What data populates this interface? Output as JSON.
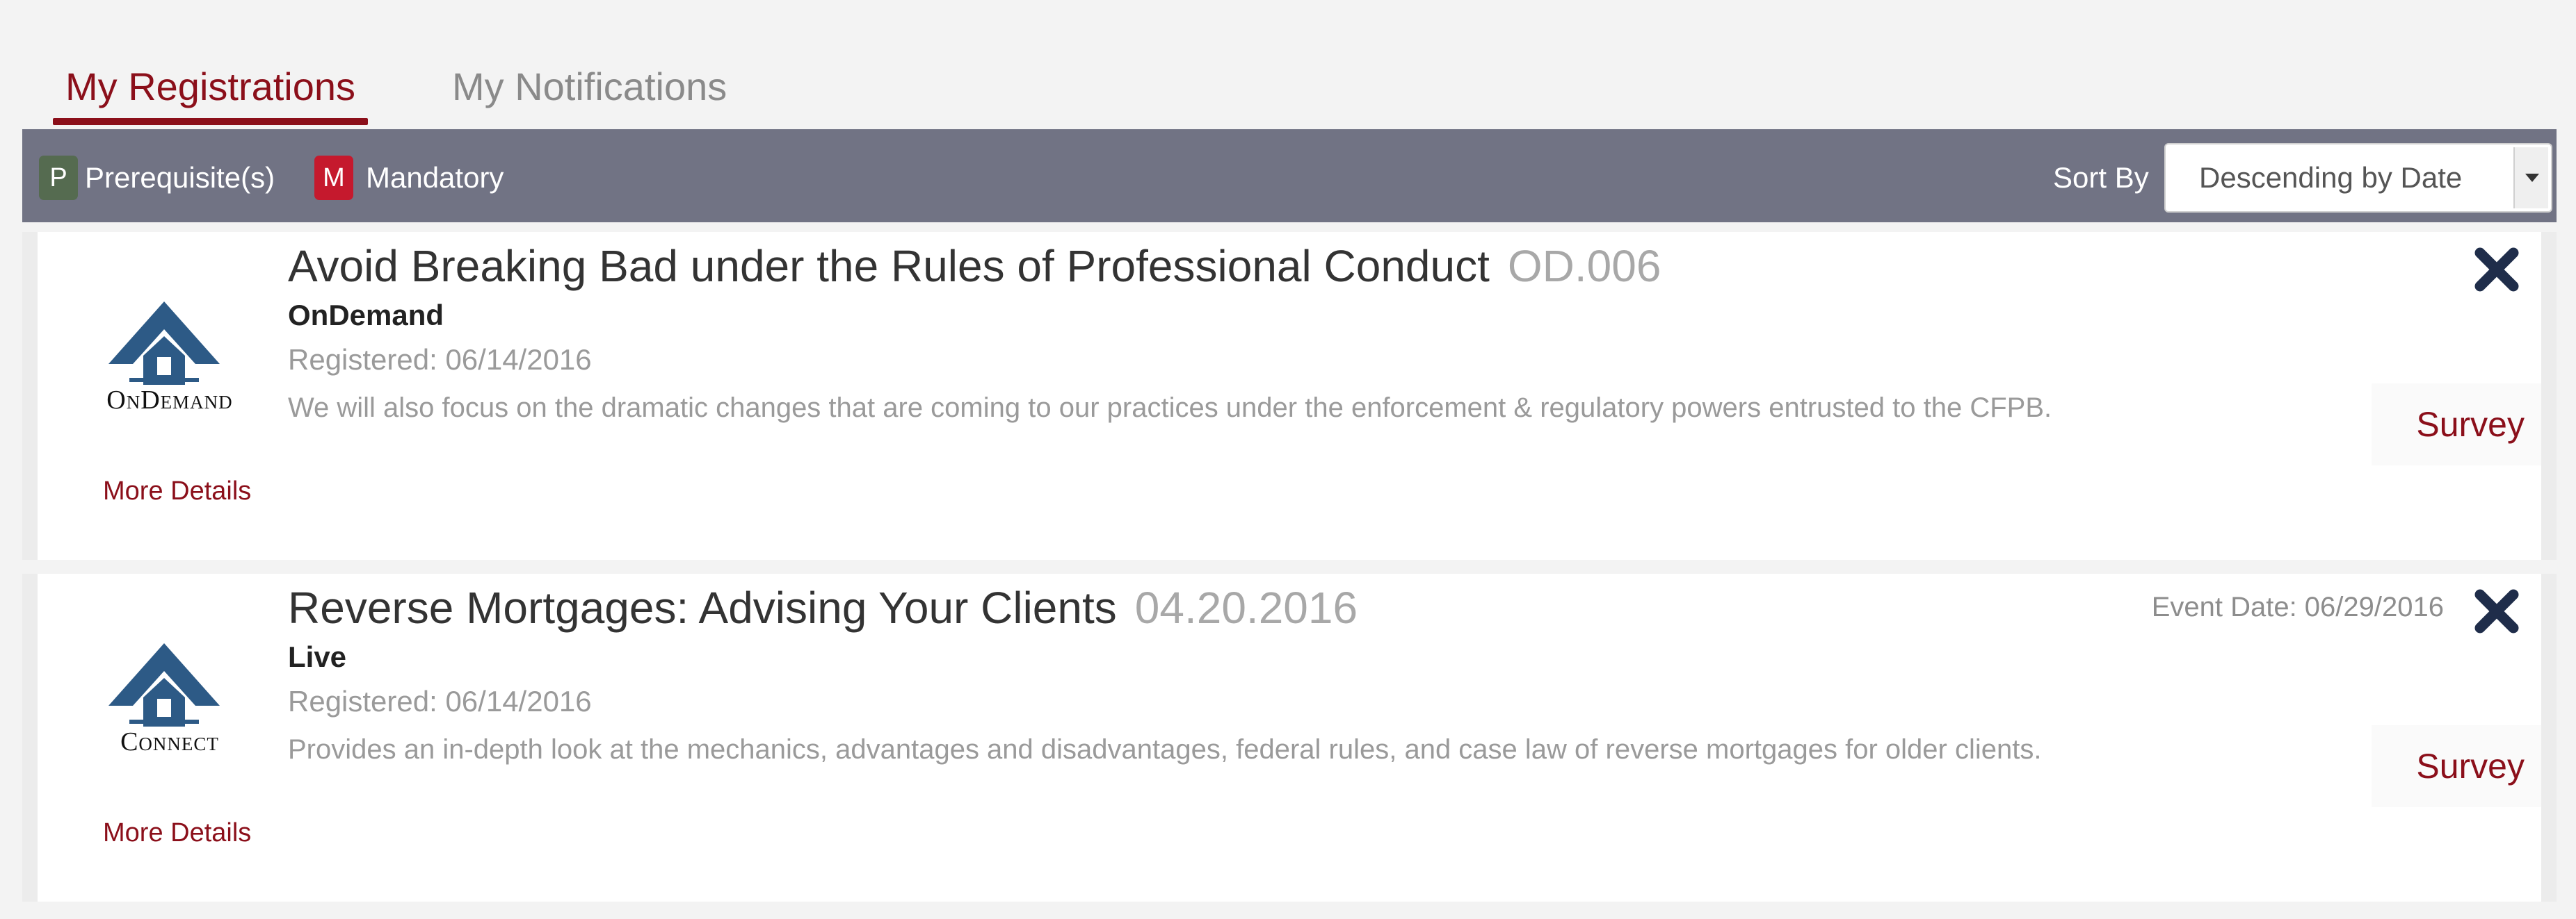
{
  "tabs": [
    {
      "label": "My Registrations",
      "active": true
    },
    {
      "label": "My Notifications",
      "active": false
    }
  ],
  "toolbar": {
    "legend": [
      {
        "badge": "P",
        "label": "Prerequisite(s)",
        "color": "#556b50"
      },
      {
        "badge": "M",
        "label": "Mandatory",
        "color": "#c5192d"
      }
    ],
    "sort_label": "Sort By",
    "sort_value": "Descending by Date"
  },
  "registrations": [
    {
      "logo_caption": "OnDemand",
      "title": "Avoid Breaking Bad under the Rules of Professional Conduct",
      "code": "OD.006",
      "type": "OnDemand",
      "registered": "Registered: 06/14/2016",
      "description": "We will also focus on the dramatic changes that are coming to our practices under the enforcement & regulatory powers entrusted to the CFPB.",
      "more_details": "More Details",
      "survey": "Survey"
    },
    {
      "logo_caption": "Connect",
      "title": "Reverse Mortgages: Advising Your Clients",
      "code": "04.20.2016",
      "type": "Live",
      "registered": "Registered: 06/14/2016",
      "event_date": "Event Date: 06/29/2016",
      "description": "Provides an in-depth look at the mechanics, advantages and disadvantages, federal rules, and case law of reverse mortgages for older clients.",
      "more_details": "More Details",
      "survey": "Survey"
    }
  ],
  "colors": {
    "accent": "#8b0f1a",
    "toolbar_bg": "#717384",
    "logo_blue": "#2d5a86"
  },
  "icons": [
    "logo-house-icon",
    "close-icon",
    "chevron-down-icon"
  ]
}
